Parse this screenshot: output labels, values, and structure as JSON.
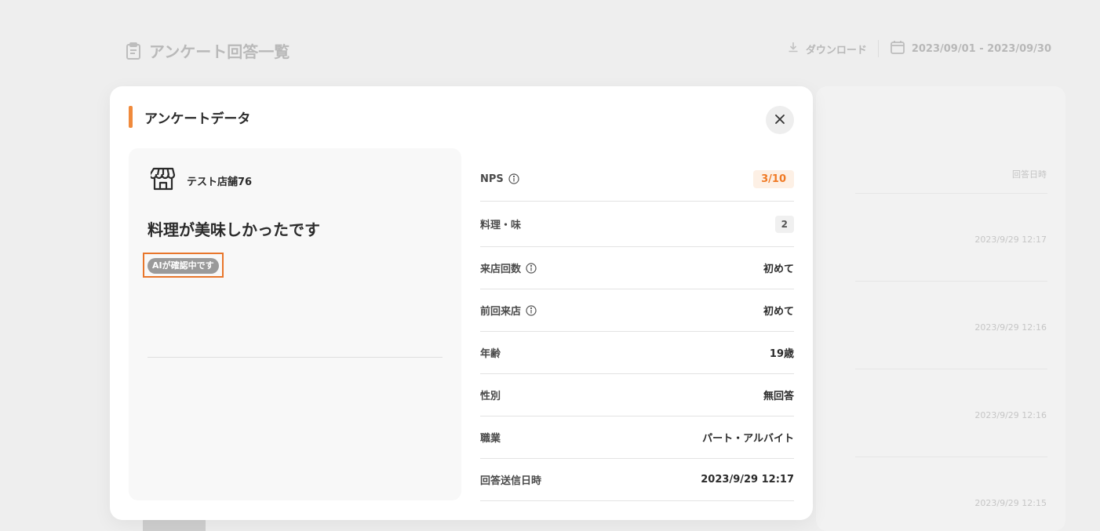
{
  "background": {
    "page_title": "アンケート回答一覧",
    "download_label": "ダウンロード",
    "date_range": "2023/09/01 - 2023/09/30",
    "column_header": "回答日時",
    "rows": [
      "2023/9/29 12:17",
      "2023/9/29 12:16",
      "2023/9/29 12:16",
      "2023/9/29 12:15"
    ]
  },
  "modal": {
    "title": "アンケートデータ",
    "store_name": "テスト店舗76",
    "comment": "料理が美味しかったです",
    "ai_badge": "AIが確認中です",
    "fields": {
      "nps": {
        "label": "NPS",
        "value": "3/10"
      },
      "taste": {
        "label": "料理・味",
        "value": "2"
      },
      "visit_count": {
        "label": "来店回数",
        "value": "初めて"
      },
      "last_visit": {
        "label": "前回来店",
        "value": "初めて"
      },
      "age": {
        "label": "年齢",
        "value": "19歳"
      },
      "gender": {
        "label": "性別",
        "value": "無回答"
      },
      "occupation": {
        "label": "職業",
        "value": "パート・アルバイト"
      },
      "submitted_at": {
        "label": "回答送信日時",
        "value": "2023/9/29 12:17"
      }
    }
  },
  "colors": {
    "accent": "#f08a3c",
    "highlight_border": "#e8762b",
    "nps_text": "#f07a25",
    "nps_bg": "#fdf0e5"
  }
}
